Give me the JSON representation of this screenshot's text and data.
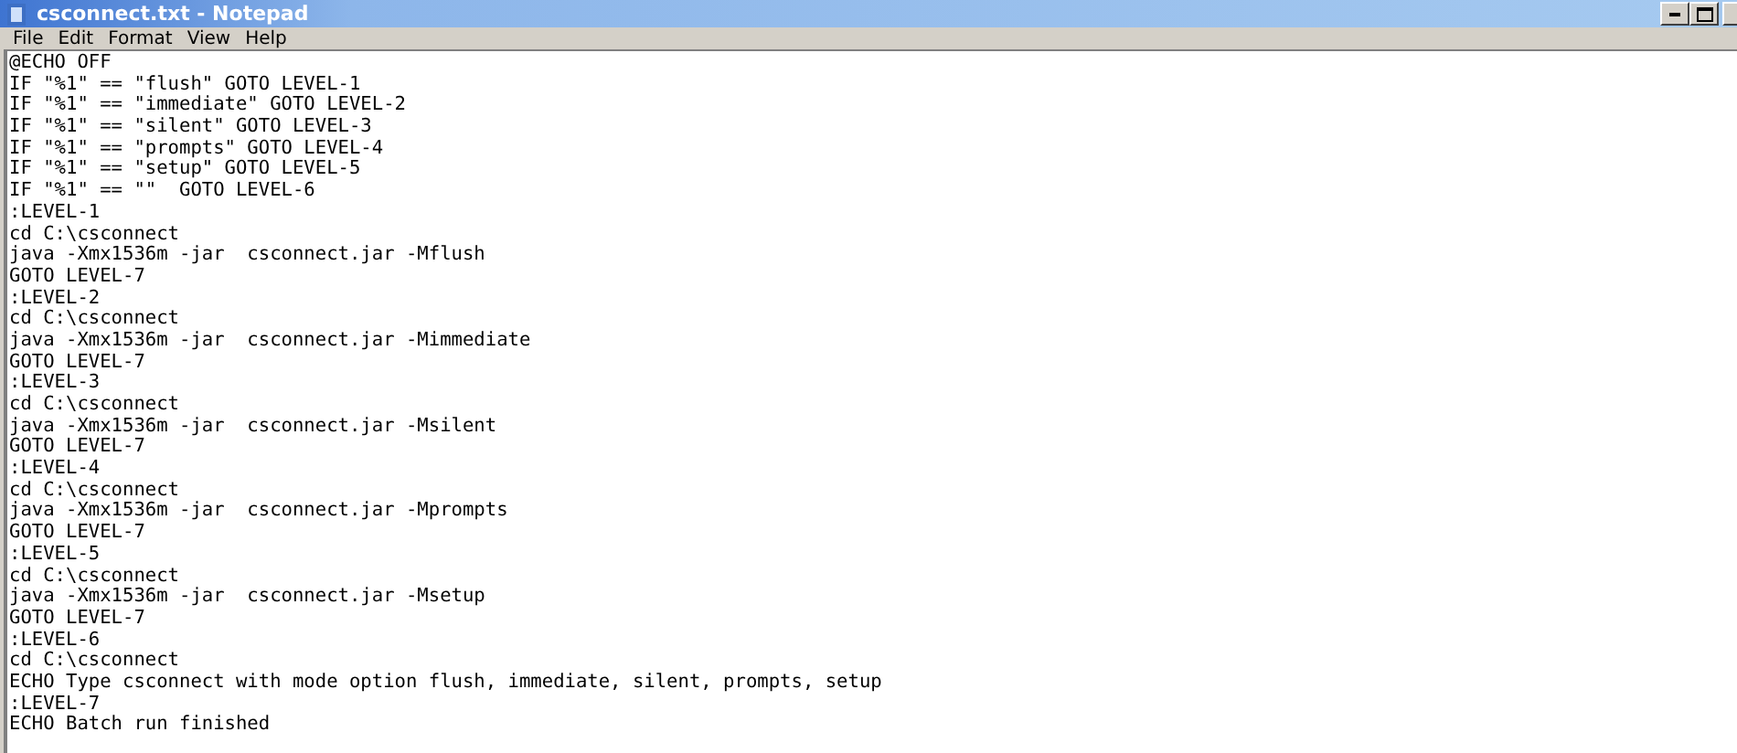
{
  "window": {
    "title": "csconnect.txt - Notepad"
  },
  "menu": [
    "File",
    "Edit",
    "Format",
    "View",
    "Help"
  ],
  "editor": {
    "lines": [
      "@ECHO OFF",
      "IF \"%1\" == \"flush\" GOTO LEVEL-1",
      "IF \"%1\" == \"immediate\" GOTO LEVEL-2",
      "IF \"%1\" == \"silent\" GOTO LEVEL-3",
      "IF \"%1\" == \"prompts\" GOTO LEVEL-4",
      "IF \"%1\" == \"setup\" GOTO LEVEL-5",
      "IF \"%1\" == \"\"  GOTO LEVEL-6",
      ":LEVEL-1",
      "cd C:\\csconnect",
      "java -Xmx1536m -jar  csconnect.jar -Mflush",
      "GOTO LEVEL-7",
      ":LEVEL-2",
      "cd C:\\csconnect",
      "java -Xmx1536m -jar  csconnect.jar -Mimmediate",
      "GOTO LEVEL-7",
      ":LEVEL-3",
      "cd C:\\csconnect",
      "java -Xmx1536m -jar  csconnect.jar -Msilent",
      "GOTO LEVEL-7",
      ":LEVEL-4",
      "cd C:\\csconnect",
      "java -Xmx1536m -jar  csconnect.jar -Mprompts",
      "GOTO LEVEL-7",
      ":LEVEL-5",
      "cd C:\\csconnect",
      "java -Xmx1536m -jar  csconnect.jar -Msetup",
      "GOTO LEVEL-7",
      ":LEVEL-6",
      "cd C:\\csconnect",
      "ECHO Type csconnect with mode option flush, immediate, silent, prompts, setup",
      ":LEVEL-7",
      "ECHO Batch run finished"
    ]
  }
}
